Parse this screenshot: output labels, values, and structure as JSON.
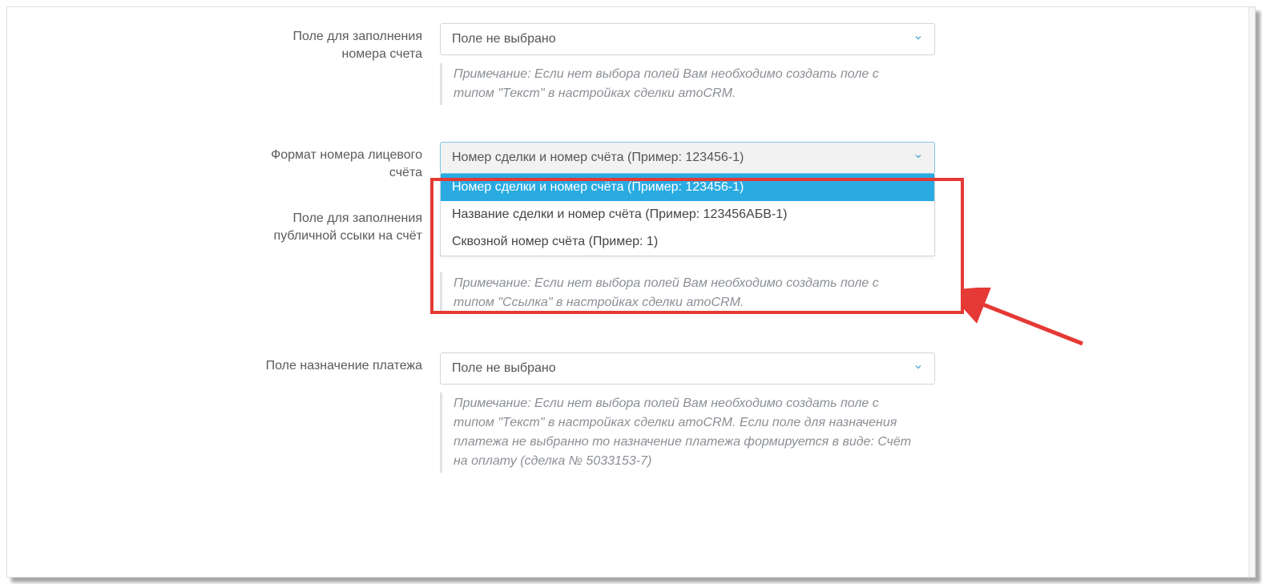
{
  "fields": {
    "account_number_field": {
      "label": "Поле для заполнения номера счета",
      "selected": "Поле не выбрано",
      "note": "Примечание: Если нет выбора полей Вам необходимо создать поле с типом \"Текст\" в настройках сделки amoCRM."
    },
    "account_format": {
      "label": "Формат номера лицевого счёта",
      "selected": "Номер сделки и номер счёта (Пример: 123456-1)",
      "options": [
        "Номер сделки и номер счёта (Пример: 123456-1)",
        "Название сделки и номер счёта (Пример: 123456АБВ-1)",
        "Сквозной номер счёта (Пример: 1)"
      ]
    },
    "public_link_field": {
      "label": "Поле для заполнения публичной ссыки на счёт",
      "note": "Примечание: Если нет выбора полей Вам необходимо создать поле с типом \"Ссылка\" в настройках сделки amoCRM."
    },
    "payment_purpose_field": {
      "label": "Поле назначение платежа",
      "selected": "Поле не выбрано",
      "note": "Примечание: Если нет выбора полей Вам необходимо создать поле с типом \"Текст\" в настройках сделки amoCRM. Если поле для назначения платежа не выбранно то назначение платежа формируется в виде: Счёт на оплату (сделка № 5033153-7)"
    }
  }
}
